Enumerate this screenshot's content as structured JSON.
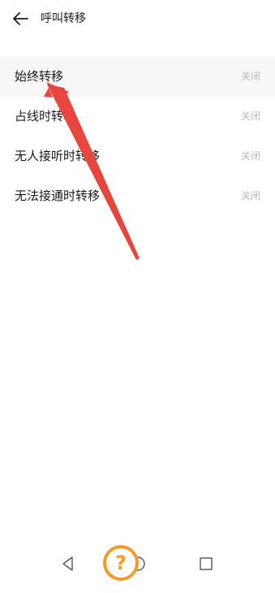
{
  "header": {
    "title": "呼叫转移",
    "back_icon": "arrow-left-icon"
  },
  "rows": [
    {
      "label": "始终转移",
      "value": "关闭"
    },
    {
      "label": "占线时转移",
      "value": "关闭"
    },
    {
      "label": "无人接听时转移",
      "value": "关闭"
    },
    {
      "label": "无法接通时转移",
      "value": "关闭"
    }
  ],
  "annotation": {
    "arrow_color": "#e8453c",
    "help_badge": "?",
    "help_badge_color": "#f39a2a"
  },
  "navbar": {
    "back_icon": "triangle-back-icon",
    "home_icon": "circle-home-icon",
    "recent_icon": "square-recent-icon"
  }
}
